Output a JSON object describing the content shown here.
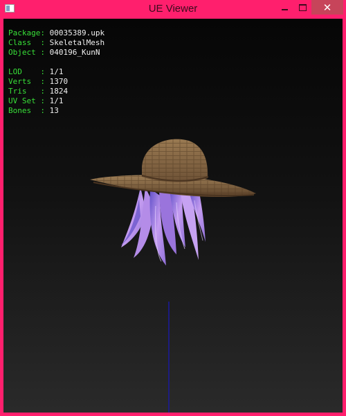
{
  "window": {
    "title": "UE Viewer",
    "controls": {
      "minimize": "—",
      "maximize": "☐",
      "close": "✕"
    }
  },
  "info": {
    "package_key": "Package:",
    "package": "00035389.upk",
    "class_key": "Class  :",
    "class": "SkeletalMesh",
    "object_key": "Object :",
    "object": "040196_KunN",
    "lod_key": "LOD    :",
    "lod": "1/1",
    "verts_key": "Verts  :",
    "verts": "1370",
    "tris_key": "Tris   :",
    "tris": "1824",
    "uvset_key": "UV Set :",
    "uvset": "1/1",
    "bones_key": "Bones  :",
    "bones": "13"
  },
  "colors": {
    "titlebar": "#ff1f6d",
    "close_button": "#c7445a",
    "info_key": "#38e038",
    "info_value": "#f0f0f0",
    "hat": "#8a6a45",
    "hair": "#a57de0",
    "axis": "#1a1aa0"
  },
  "icons": [
    "app-icon",
    "minimize-icon",
    "maximize-icon",
    "close-icon"
  ]
}
